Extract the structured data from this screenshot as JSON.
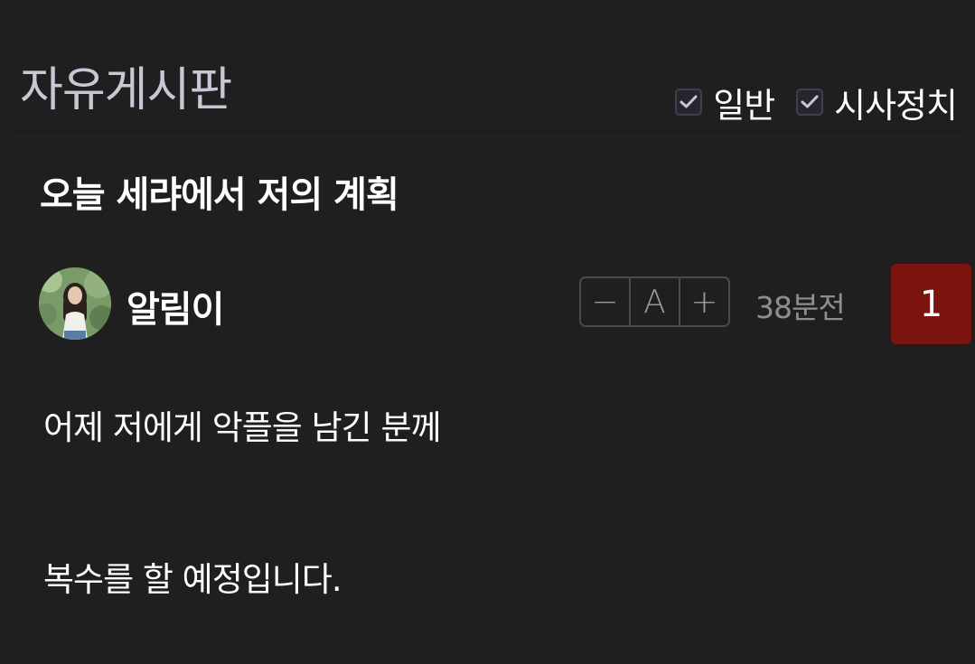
{
  "board": {
    "title": "자유게시판",
    "filters": [
      {
        "label": "일반",
        "checked": true
      },
      {
        "label": "시사정치",
        "checked": true
      }
    ]
  },
  "post": {
    "title": "오늘 세랴에서 저의 계획",
    "author": "알림이",
    "time": "38분전",
    "comment_count": "1",
    "font_controls": {
      "decrease": "−",
      "reset": "A",
      "increase": "+"
    },
    "body": [
      "어제 저에게 악플을 남긴 분께",
      "",
      "복수를 할 예정입니다."
    ]
  },
  "colors": {
    "background": "#1f1f1f",
    "board_title": "#c9c7d4",
    "comment_badge": "#7a140c",
    "meta_text": "#8e8e8e"
  },
  "icons": {
    "checkbox": "check-icon",
    "avatar": "user-avatar-photo"
  }
}
